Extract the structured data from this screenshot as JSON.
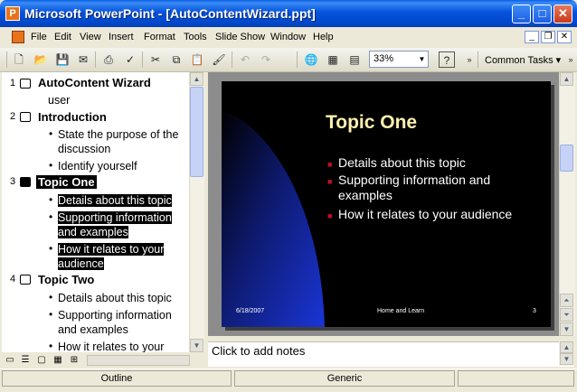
{
  "window": {
    "title": "Microsoft PowerPoint - [AutoContentWizard.ppt]"
  },
  "menu": {
    "items": [
      {
        "label": "File"
      },
      {
        "label": "Edit"
      },
      {
        "label": "View"
      },
      {
        "label": "Insert"
      },
      {
        "label": "Format"
      },
      {
        "label": "Tools"
      },
      {
        "label": "Slide Show"
      },
      {
        "label": "Window"
      },
      {
        "label": "Help"
      }
    ]
  },
  "toolbar": {
    "zoom": "33%",
    "common_tasks": "Common Tasks"
  },
  "outline": {
    "slides": [
      {
        "num": "1",
        "title": "AutoContent Wizard",
        "sub": "user",
        "bullets": []
      },
      {
        "num": "2",
        "title": "Introduction",
        "bullets": [
          "State the purpose of the",
          "discussion",
          "Identify yourself"
        ]
      },
      {
        "num": "3",
        "title": "Topic One",
        "bullets": [
          "Details about this topic",
          "Supporting information",
          "and examples",
          "How it relates to your",
          "audience"
        ]
      },
      {
        "num": "4",
        "title": "Topic Two",
        "bullets": [
          "Details about this topic",
          "Supporting information",
          "and examples",
          "How it relates to your"
        ]
      }
    ]
  },
  "slide": {
    "title": "Topic One",
    "bullets": [
      "Details about this topic",
      "Supporting information and",
      "examples",
      "How it relates to your audience"
    ],
    "footer_date": "6/18/2007",
    "footer_center": "Home and Learn",
    "footer_page": "3",
    "colors": {
      "background": "#000000",
      "title": "#fff1b0",
      "bullet_mark": "#c0102a",
      "accent_shape": "#1a35d6"
    }
  },
  "notes": {
    "placeholder": "Click to add notes"
  },
  "status": {
    "view": "Outline",
    "design": "Generic"
  }
}
